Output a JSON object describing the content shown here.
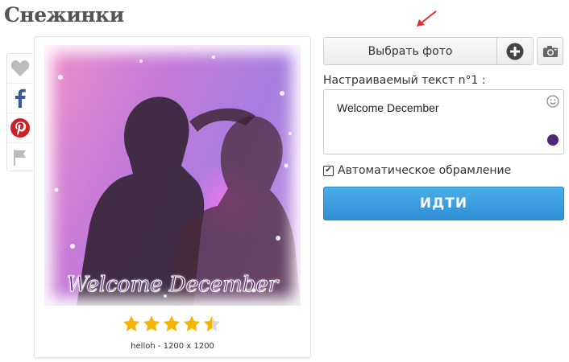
{
  "page": {
    "title": "Снежинки"
  },
  "share": {
    "icons": [
      "heart-icon",
      "facebook-icon",
      "pinterest-icon",
      "flag-icon"
    ],
    "colors": {
      "facebook": "#3b5998",
      "pinterest": "#cb2027",
      "muted": "#bbbbbb"
    }
  },
  "preview": {
    "overlay_text": "Welcome December",
    "rating": {
      "stars": 4.5,
      "max": 5,
      "color": "#f5b400"
    },
    "meta": "helloh - 1200 x 1200"
  },
  "controls": {
    "choose_photo": "Выбрать фото",
    "text_label": "Настраиваемый текст n°1 :",
    "text_value": "Welcome December",
    "text_color": "#4a2a7a",
    "auto_frame_label": "Автоматическое обрамление",
    "auto_frame_checked": true,
    "go_button": "ИДТИ",
    "accent": "#3a9ee4",
    "arrow_color": "#e03030"
  }
}
